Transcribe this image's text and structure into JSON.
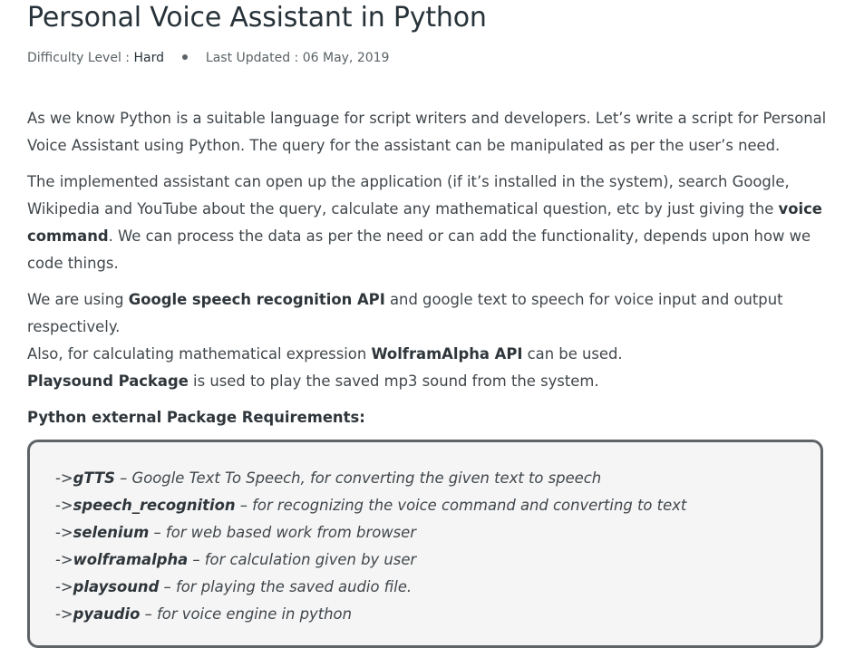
{
  "article": {
    "title": "Personal Voice Assistant in Python",
    "meta": {
      "difficulty_label": "Difficulty Level : ",
      "difficulty_value": "Hard",
      "updated_label": "Last Updated : ",
      "updated_value": "06 May, 2019"
    },
    "p1": "As we know Python is a suitable language for script writers and developers. Let’s write a script for Personal Voice Assistant using Python. The query for the assistant can be manipulated as per the user’s need.",
    "p2": {
      "a": "The implemented assistant can open up the application (if it’s installed in the system), search Google, Wikipedia and YouTube about the query, calculate any mathematical question, etc by just giving the ",
      "b": "voice command",
      "c": ". We can process the data as per the need or can add the functionality, depends upon how we code things."
    },
    "p3": {
      "a": "We are using ",
      "b": "Google speech recognition API",
      "c": " and google text to speech for voice input and output respectively.",
      "d": "Also, for calculating mathematical expression ",
      "e": "WolframAlpha API",
      "f": " can be used.",
      "g": "Playsound Package",
      "h": " is used to play the saved mp3 sound from the system."
    },
    "req_heading": "Python external Package Requirements:",
    "requirements": [
      {
        "arrow": "->",
        "pkg": "gTTS",
        "desc": " – Google Text To Speech, for converting the given text to speech"
      },
      {
        "arrow": "->",
        "pkg": "speech_recognition",
        "desc": " – for recognizing the voice command and converting to text"
      },
      {
        "arrow": "->",
        "pkg": "selenium",
        "desc": " – for web based work from browser"
      },
      {
        "arrow": "->",
        "pkg": "wolframalpha",
        "desc": " – for calculation given by user"
      },
      {
        "arrow": "->",
        "pkg": "playsound",
        "desc": " – for playing the saved audio file."
      },
      {
        "arrow": "->",
        "pkg": "pyaudio",
        "desc": " – for voice engine in python"
      }
    ]
  }
}
